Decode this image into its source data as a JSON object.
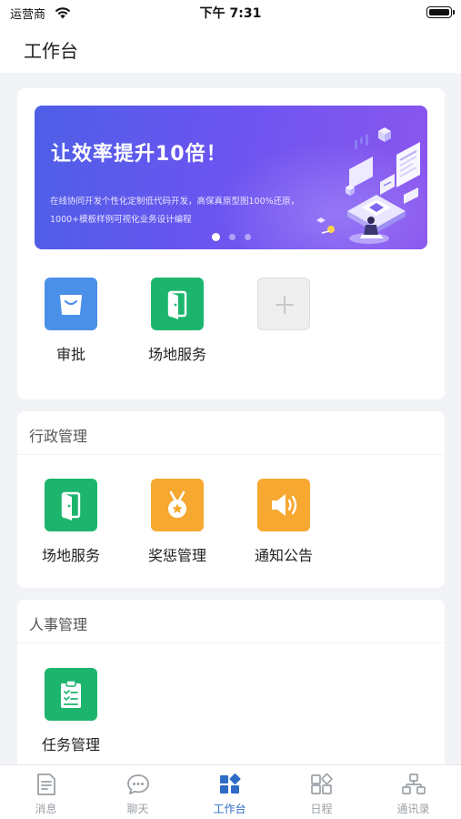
{
  "status_bar": {
    "carrier": "运营商",
    "time": "下午 7:31"
  },
  "header": {
    "title": "工作台"
  },
  "banner": {
    "title": "让效率提升10倍！",
    "description": "在线协同开发个性化定制低代码开发，高保真原型图100%还原，1000+模板样例可视化业务设计编程",
    "slide_count": 3,
    "active_slide": 1
  },
  "quick_apps": [
    {
      "label": "审批",
      "icon": "shopping-bag-icon",
      "color": "#4a90e8"
    },
    {
      "label": "场地服务",
      "icon": "door-icon",
      "color": "#1db56d"
    },
    {
      "label": "",
      "icon": "plus-icon",
      "color": "#eeeeee"
    }
  ],
  "sections": [
    {
      "title": "行政管理",
      "items": [
        {
          "label": "场地服务",
          "icon": "door-icon",
          "color": "#1db56d"
        },
        {
          "label": "奖惩管理",
          "icon": "medal-icon",
          "color": "#f6a830"
        },
        {
          "label": "通知公告",
          "icon": "speaker-icon",
          "color": "#f6a830"
        }
      ]
    },
    {
      "title": "人事管理",
      "items": [
        {
          "label": "任务管理",
          "icon": "clipboard-checklist-icon",
          "color": "#1db56d"
        }
      ]
    }
  ],
  "tab_bar": {
    "active_index": 2,
    "active_color": "#2e6bc6",
    "inactive_color": "#9aa0a6",
    "tabs": [
      {
        "label": "消息",
        "icon": "message-doc-icon"
      },
      {
        "label": "聊天",
        "icon": "chat-bubble-icon"
      },
      {
        "label": "工作台",
        "icon": "workbench-grid-icon"
      },
      {
        "label": "日程",
        "icon": "schedule-grid-icon"
      },
      {
        "label": "通讯录",
        "icon": "org-chart-icon"
      }
    ]
  }
}
